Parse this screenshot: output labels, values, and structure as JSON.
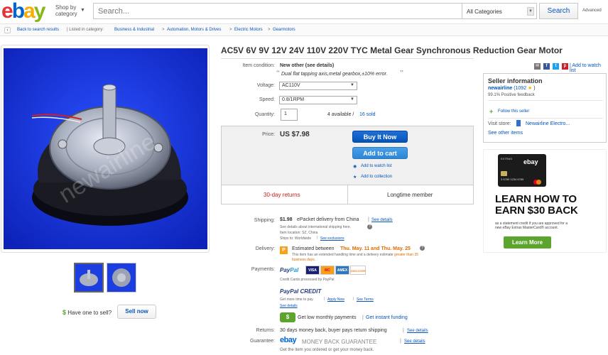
{
  "header": {
    "logo_letters": [
      "e",
      "b",
      "a",
      "y"
    ],
    "shop_by": "Shop by",
    "category": "category",
    "search_placeholder": "Search...",
    "category_select": "All Categories",
    "search_button": "Search",
    "advanced": "Advanced"
  },
  "breadcrumb": {
    "back": "Back to search results",
    "listed_in": "| Listed in category:",
    "items": [
      "Business & Industrial",
      "Automation, Motors & Drives",
      "Electric Motors",
      "Gearmotors"
    ],
    "separator": ">"
  },
  "product": {
    "title": "AC5V 6V 9V 12V 24V 110V 220V TYC Metal Gear Synchronous Reduction Gear Motor",
    "watermark": "newairline",
    "condition_label": "Item condition:",
    "condition_value": "New other (see details)",
    "condition_note": "Dual flat tapping axis,metal gearbox,±10% error.",
    "voltage_label": "Voltage:",
    "voltage_value": "AC110V",
    "speed_label": "Speed:",
    "speed_value": "0.8/1RPM",
    "quantity_label": "Quantity:",
    "quantity_value": "1",
    "available": "4 available /",
    "sold": "16 sold",
    "price_label": "Price:",
    "price_value": "US $7.98",
    "buy_now": "Buy It Now",
    "add_to_cart": "Add to cart",
    "add_to_watch": "Add to watch list",
    "add_to_collection": "Add to collection",
    "returns_badge": "30-day returns",
    "longtime_member": "Longtime member",
    "share_add_watch": "| Add to watch list"
  },
  "shipping": {
    "label": "Shipping:",
    "cost": "$1.98",
    "method": "ePacket delivery from China",
    "see_details": "See details",
    "intl_note": "See details about international shipping here.",
    "item_location": "Item location:  SZ, China",
    "ships_to": "Ships to:  Worldwide",
    "see_exclusions": "See exclusions"
  },
  "delivery": {
    "label": "Delivery:",
    "prefix": "Estimated between",
    "range": "Thu. May. 11 and Thu. May. 25",
    "note1": "This item has an extended handling time and a delivery estimate",
    "note_highlight": "greater than 35",
    "note2": "business days."
  },
  "payments": {
    "label": "Payments:",
    "paypal1": "Pay",
    "paypal2": "Pal",
    "cards": [
      "VISA",
      "MC",
      "AMEX",
      "DISCOVER"
    ],
    "processed": "Credit Cards processed by PayPal",
    "credit_title": "PayPal CREDIT",
    "credit_note": "Get more time to pay.",
    "apply_now": "Apply Now",
    "see_terms": "See Terms",
    "see_details": "See details",
    "monthly": "Get low monthly payments",
    "instant": "Get instant funding",
    "green_icon": "$"
  },
  "returns": {
    "label": "Returns:",
    "text": "30 days money back, buyer pays return shipping",
    "see_details": "See details"
  },
  "guarantee": {
    "label": "Guarantee:",
    "brand": "ebay",
    "title": "MONEY BACK GUARANTEE",
    "see_details": "See details",
    "note": "Get the item you ordered or get your money back."
  },
  "seller": {
    "heading": "Seller information",
    "name": "newairline",
    "score": "(1092",
    "feedback": "99.1% Positive feedback",
    "follow": "Follow this seller",
    "visit_store": "Visit store:",
    "store_name": "Newairline Electro...",
    "see_other": "See other items"
  },
  "ad": {
    "headline1": "LEARN HOW TO",
    "headline2": "EARN $30 BACK",
    "fine1": "as a statement credit if you are approved for a",
    "fine2": "new eBay Extras MasterCard® account.",
    "button": "Learn More",
    "card_brand": "ebay",
    "card_label": "EXTRAS",
    "card_number": "3 6789 1234 6789"
  },
  "sell": {
    "question": "Have one to sell?",
    "button": "Sell now",
    "dollar": "$"
  },
  "colors": {
    "link": "#0654ba",
    "buy_blue": "#0654ba",
    "cart_blue": "#2d86d6",
    "returns_red": "#c91d1d",
    "delivery_orange": "#dd6b00",
    "learn_green": "#5ba42e",
    "product_bg": "#1c3ee0"
  }
}
